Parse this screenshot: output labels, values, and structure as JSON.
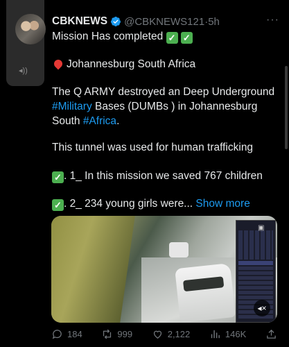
{
  "tweet": {
    "author_name": "CBKNEWS",
    "handle": "@CBKNEWS121",
    "time_sep": " · ",
    "time": "5h",
    "more": "···",
    "line1": "Mission Has completed",
    "location": "Johannesburg South Africa",
    "para1_a": "The Q ARMY destroyed an Deep Underground ",
    "para1_tag1": "#Military",
    "para1_b": " Bases (DUMBs ) in Johannesburg South ",
    "para1_tag2": "#Africa",
    "para1_c": ".",
    "para2": "This tunnel was used for human trafficking",
    "item1": ". 1_ In this mission we saved 767 children",
    "item2": ". 2_ 234 young girls were...",
    "show_more": "Show more"
  },
  "actions": {
    "replies": "184",
    "retweets": "999",
    "likes": "2,122",
    "views": "146K"
  },
  "colors": {
    "accent": "#1d9bf0",
    "muted": "#71767b",
    "check": "#4caf50"
  }
}
